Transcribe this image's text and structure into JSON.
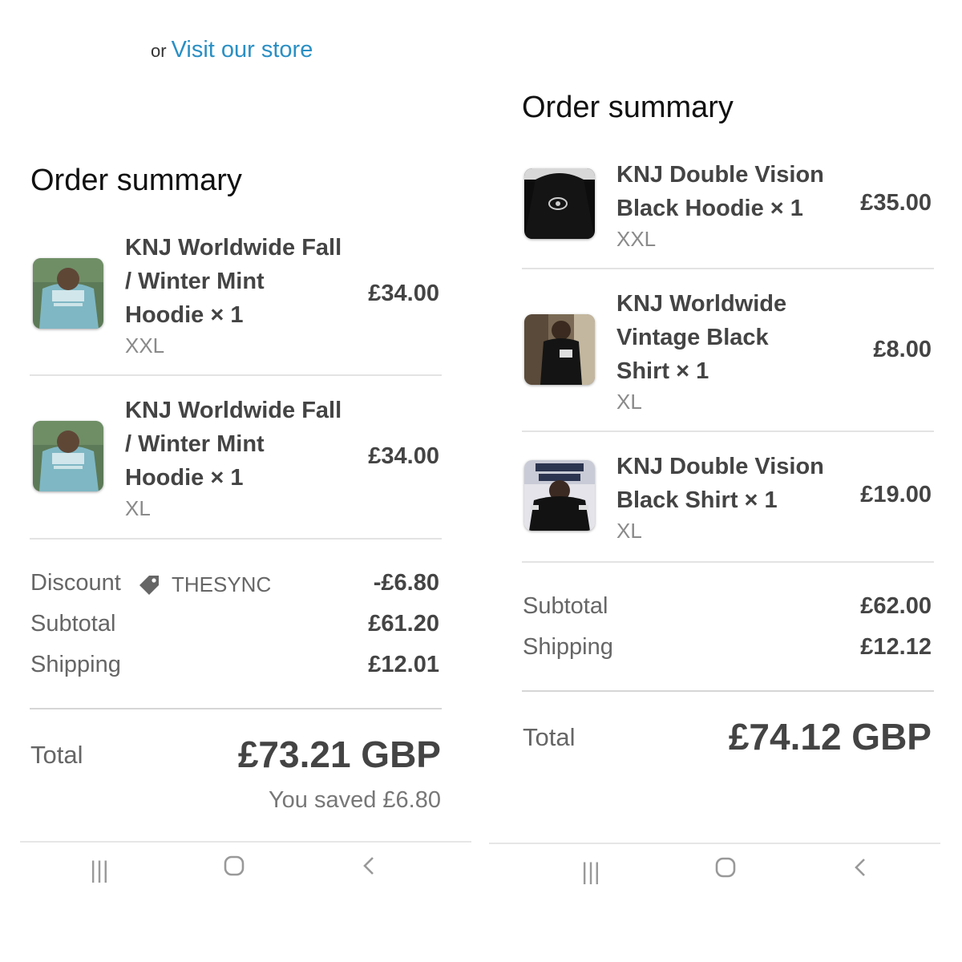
{
  "left": {
    "visit": {
      "or_text": "or",
      "link_text": "Visit our store"
    },
    "heading": "Order summary",
    "items": [
      {
        "name_lines": [
          "KNJ Worldwide Fall",
          "/ Winter Mint",
          "Hoodie × 1"
        ],
        "variant": "XXL",
        "price": "£34.00",
        "thumb": "mint-hoodie-photo"
      },
      {
        "name_lines": [
          "KNJ Worldwide Fall",
          "/ Winter Mint",
          "Hoodie × 1"
        ],
        "variant": "XL",
        "price": "£34.00",
        "thumb": "mint-hoodie-photo"
      }
    ],
    "discount": {
      "label": "Discount",
      "code": "THESYNC",
      "value": "-£6.80",
      "icon": "tag-icon"
    },
    "subtotal": {
      "label": "Subtotal",
      "value": "£61.20"
    },
    "shipping": {
      "label": "Shipping",
      "value": "£12.01"
    },
    "total": {
      "label": "Total",
      "value": "£73.21 GBP",
      "saved": "You saved £6.80"
    }
  },
  "right": {
    "heading": "Order summary",
    "items": [
      {
        "name_lines": [
          "KNJ Double Vision",
          "Black Hoodie × 1"
        ],
        "variant": "XXL",
        "price": "£35.00",
        "thumb": "black-hoodie-photo"
      },
      {
        "name_lines": [
          "KNJ Worldwide",
          "Vintage Black",
          "Shirt × 1"
        ],
        "variant": "XL",
        "price": "£8.00",
        "thumb": "black-shirt-photo"
      },
      {
        "name_lines": [
          "KNJ Double Vision",
          "Black Shirt × 1"
        ],
        "variant": "XL",
        "price": "£19.00",
        "thumb": "double-vision-shirt-photo"
      }
    ],
    "subtotal": {
      "label": "Subtotal",
      "value": "£62.00"
    },
    "shipping": {
      "label": "Shipping",
      "value": "£12.12"
    },
    "total": {
      "label": "Total",
      "value": "£74.12 GBP"
    }
  },
  "navbar": {
    "icons": [
      "recent-apps-icon",
      "home-icon",
      "back-icon"
    ]
  },
  "colors": {
    "link": "#2a8fc4",
    "text": "#444444",
    "muted": "#8a8a8a"
  }
}
